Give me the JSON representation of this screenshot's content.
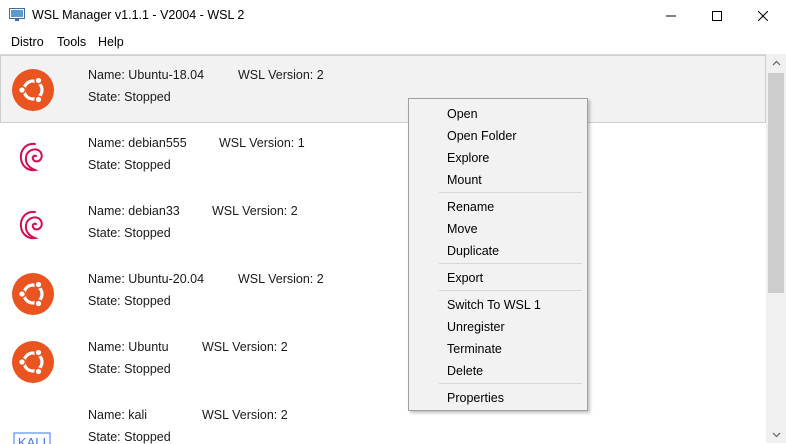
{
  "window": {
    "title": "WSL Manager v1.1.1 - V2004 - WSL 2"
  },
  "menu": [
    "Distro",
    "Tools",
    "Help"
  ],
  "distros": [
    {
      "name": "Name: Ubuntu-18.04",
      "version": "WSL Version: 2",
      "state": "State: Stopped",
      "icon": "ubuntu-logo-icon"
    },
    {
      "name": "Name: debian555",
      "version": "WSL Version: 1",
      "state": "State: Stopped",
      "icon": "debian-logo-icon"
    },
    {
      "name": "Name: debian33",
      "version": "WSL Version: 2",
      "state": "State: Stopped",
      "icon": "debian-logo-icon"
    },
    {
      "name": "Name: Ubuntu-20.04",
      "version": "WSL Version: 2",
      "state": "State: Stopped",
      "icon": "ubuntu-logo-icon"
    },
    {
      "name": "Name: Ubuntu",
      "version": "WSL Version: 2",
      "state": "State: Stopped",
      "icon": "ubuntu-logo-icon"
    },
    {
      "name": "Name: kali",
      "version": "WSL Version: 2",
      "state": "State: Stopped",
      "icon": "kali-logo-icon",
      "logo_text": "KALI"
    }
  ],
  "context_menu": {
    "items": [
      "Open",
      "Open Folder",
      "Explore",
      "Mount",
      "Rename",
      "Move",
      "Duplicate",
      "Export",
      "Switch To WSL 1",
      "Unregister",
      "Terminate",
      "Delete",
      "Properties"
    ]
  },
  "colors": {
    "ubuntu_orange": "#e95420",
    "debian_red": "#d70a53",
    "kali_blue": "#367bf0"
  }
}
